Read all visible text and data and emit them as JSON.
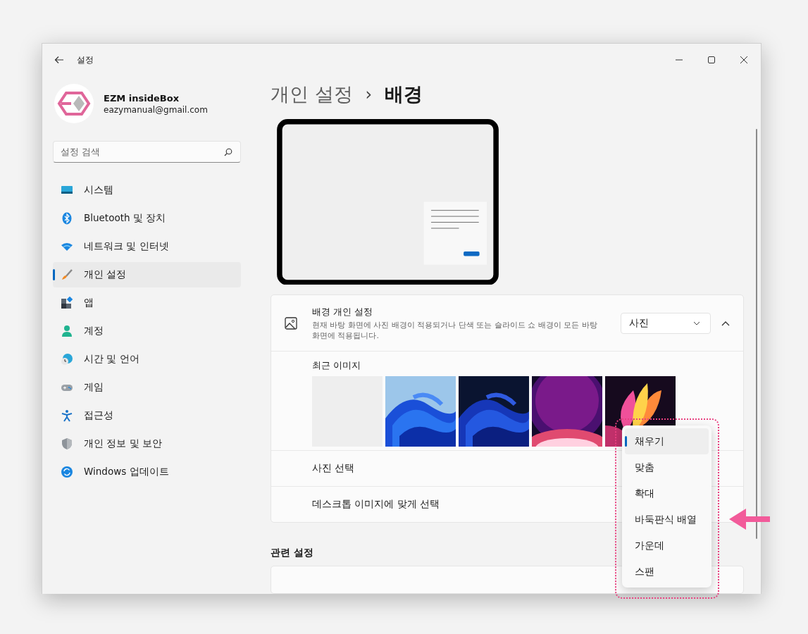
{
  "window": {
    "title": "설정"
  },
  "account": {
    "name": "EZM insideBox",
    "email": "eazymanual@gmail.com"
  },
  "search": {
    "placeholder": "설정 검색"
  },
  "nav": [
    {
      "label": "시스템",
      "kind": "system",
      "selected": false
    },
    {
      "label": "Bluetooth 및 장치",
      "kind": "bluetooth",
      "selected": false
    },
    {
      "label": "네트워크 및 인터넷",
      "kind": "wifi",
      "selected": false
    },
    {
      "label": "개인 설정",
      "kind": "brush",
      "selected": true
    },
    {
      "label": "앱",
      "kind": "apps",
      "selected": false
    },
    {
      "label": "계정",
      "kind": "person",
      "selected": false
    },
    {
      "label": "시간 및 언어",
      "kind": "clock",
      "selected": false
    },
    {
      "label": "게임",
      "kind": "gamepad",
      "selected": false
    },
    {
      "label": "접근성",
      "kind": "accessibility",
      "selected": false
    },
    {
      "label": "개인 정보 및 보안",
      "kind": "shield",
      "selected": false
    },
    {
      "label": "Windows 업데이트",
      "kind": "update",
      "selected": false
    }
  ],
  "breadcrumb": {
    "parent": "개인 설정",
    "separator": "›",
    "current": "배경"
  },
  "background": {
    "title": "배경 개인 설정",
    "description": "현재 바탕 화면에 사진 배경이 적용되거나 단색 또는 슬라이드 쇼 배경이 모든 바탕 화면에 적용됩니다.",
    "dropdown": {
      "value": "사진"
    },
    "expanded": true
  },
  "recent_images": {
    "label": "최근 이미지",
    "images": [
      {
        "kind": "blank"
      },
      {
        "kind": "bloom"
      },
      {
        "kind": "bloomdark"
      },
      {
        "kind": "glow"
      },
      {
        "kind": "flower"
      }
    ]
  },
  "rows": [
    {
      "label": "사진 선택"
    },
    {
      "label": "데스크톱 이미지에 맞게 선택"
    }
  ],
  "related": {
    "heading": "관련 설정"
  },
  "fit_menu": [
    {
      "label": "채우기",
      "selected": true
    },
    {
      "label": "맞춤",
      "selected": false
    },
    {
      "label": "확대",
      "selected": false
    },
    {
      "label": "바둑판식 배열",
      "selected": false
    },
    {
      "label": "가운데",
      "selected": false
    },
    {
      "label": "스팬",
      "selected": false
    }
  ]
}
